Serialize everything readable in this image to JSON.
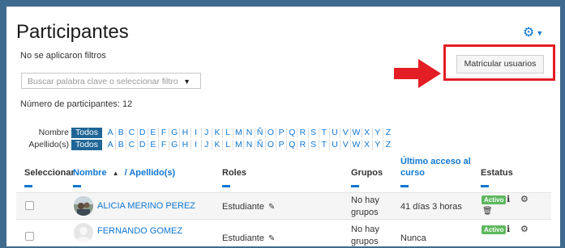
{
  "page": {
    "title": "Participantes",
    "filters_text": "No se aplicaron filtros",
    "participants_count": "Número de participantes: 12"
  },
  "search": {
    "placeholder": "Buscar palabra clave o seleccionar filtro"
  },
  "actions": {
    "enrol_label": "Matricular usuarios"
  },
  "initials_filter": {
    "first_label": "Nombre",
    "last_label": "Apellido(s)",
    "all_label": "Todos",
    "letters": [
      "A",
      "B",
      "C",
      "D",
      "E",
      "F",
      "G",
      "H",
      "I",
      "J",
      "K",
      "L",
      "M",
      "N",
      "Ñ",
      "O",
      "P",
      "Q",
      "R",
      "S",
      "T",
      "U",
      "V",
      "W",
      "X",
      "Y",
      "Z"
    ]
  },
  "table": {
    "headers": {
      "select": "Seleccionar",
      "name": "Nombre",
      "name_sort_glyph": "▲",
      "surname": "/ Apellido(s)",
      "roles": "Roles",
      "groups": "Grupos",
      "last_access_1": "Último acceso al",
      "last_access_2": "curso",
      "status": "Estatus"
    },
    "rows": [
      {
        "name": "ALICIA MERINO PEREZ",
        "role": "Estudiante",
        "groups_1": "No hay",
        "groups_2": "grupos",
        "last_access": "41 días 3 horas",
        "status": "Activo"
      },
      {
        "name": "FERNANDO GOMEZ",
        "role": "Estudiante",
        "groups_1": "No hay",
        "groups_2": "grupos",
        "last_access": "Nunca",
        "status": "Activo"
      }
    ]
  },
  "colors": {
    "link": "#1177d1",
    "highlight_red": "#e31e24",
    "active_green": "#5cb85c",
    "todos_bg": "#1f6596",
    "frame_blue": "#3f6a8f"
  }
}
